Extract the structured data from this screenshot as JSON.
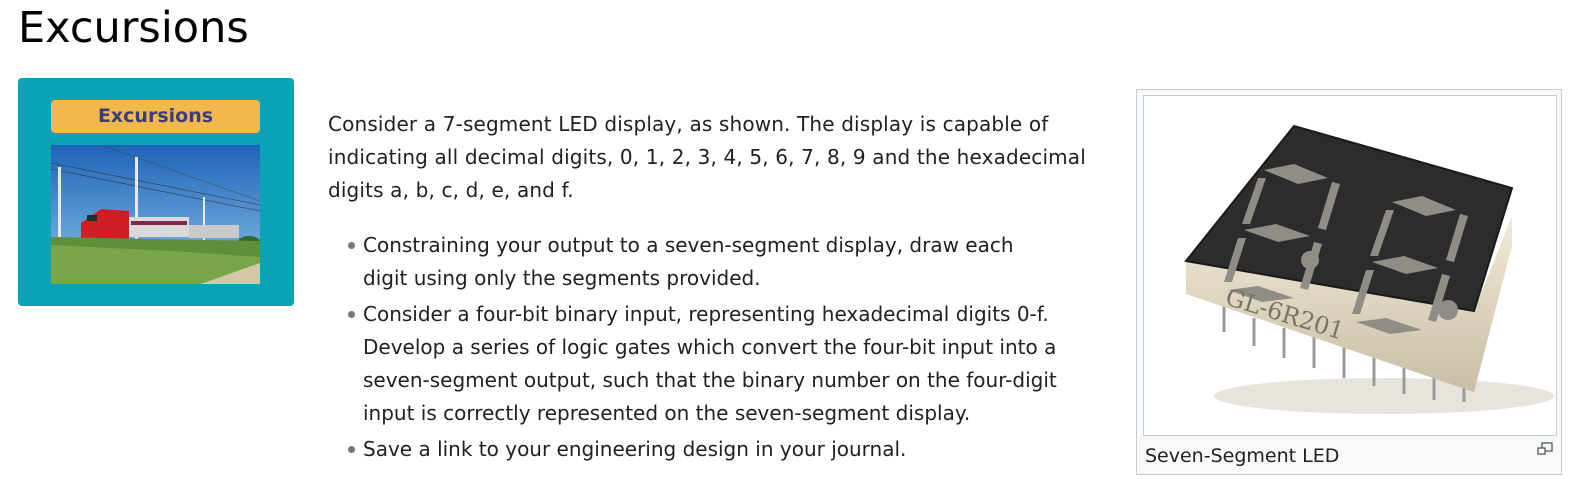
{
  "page": {
    "heading": "Excursions"
  },
  "infobox": {
    "label": "Excursions",
    "icon": "train-photo"
  },
  "content": {
    "intro": "Consider a 7-segment LED display, as shown. The display is capable of indicating all decimal digits, 0, 1, 2, 3, 4, 5, 6, 7, 8, 9 and the hexadecimal digits a, b, c, d, e, and f.",
    "bullets": [
      "Constraining your output to a seven-segment display, draw each digit using only the segments provided.",
      "Consider a four-bit binary input, representing hexadecimal digits 0-f. Develop a series of logic gates which convert the four-bit input into a seven-segment output, such that the binary number on the four-digit input is correctly represented on the seven-segment display.",
      "Save a link to your engineering design in your journal."
    ]
  },
  "figure": {
    "caption": "Seven-Segment LED",
    "icon": "enlarge-icon"
  },
  "colors": {
    "infobox_bg": "#0aa3b8",
    "label_bg": "#f2b84b",
    "label_text": "#3b3d7d"
  }
}
